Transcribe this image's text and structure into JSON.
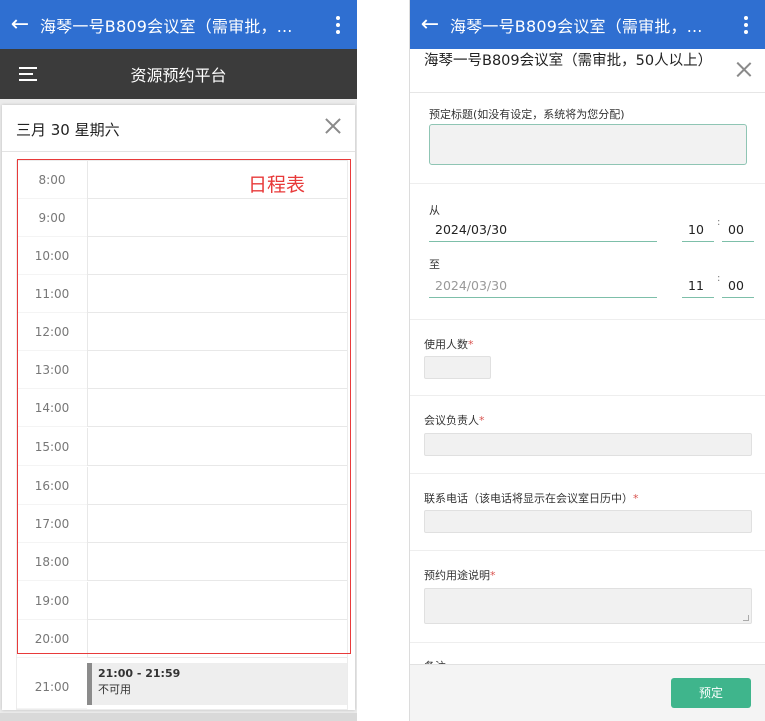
{
  "left": {
    "appbar": {
      "title": "海琴一号B809会议室（需审批，..."
    },
    "subbar": {
      "title": "资源预约平台"
    },
    "card": {
      "date": "三月 30 星期六"
    },
    "annotation": "日程表",
    "hours": [
      "8:00",
      "9:00",
      "10:00",
      "11:00",
      "12:00",
      "13:00",
      "14:00",
      "15:00",
      "16:00",
      "17:00",
      "18:00",
      "19:00",
      "20:00",
      "21:00"
    ],
    "event": {
      "time": "21:00 - 21:59",
      "status": "不可用"
    }
  },
  "right": {
    "appbar": {
      "title": "海琴一号B809会议室（需审批，..."
    },
    "dialog": {
      "title": "海琴一号B809会议室（需审批，50人以上）"
    },
    "form": {
      "booking_title_label": "预定标题(如没有设定，系统将为您分配)",
      "from_label": "从",
      "from_date": "2024/03/30",
      "from_hour": "10",
      "from_minute": "00",
      "to_label": "至",
      "to_date": "2024/03/30",
      "to_hour": "11",
      "to_minute": "00",
      "time_sep": ":",
      "attendees_label": "使用人数",
      "owner_label": "会议负责人",
      "phone_label": "联系电话（该电话将显示在会议室日历中）",
      "purpose_label": "预约用途说明",
      "notes_label": "备注",
      "required_mark": "*"
    },
    "footer": {
      "submit": "预定"
    }
  },
  "colors": {
    "appbar": "#2f6fd1",
    "subbar": "#3b3b3b",
    "annotation": "#e83a3a",
    "accent": "#3fb58c",
    "required": "#d9534f"
  }
}
